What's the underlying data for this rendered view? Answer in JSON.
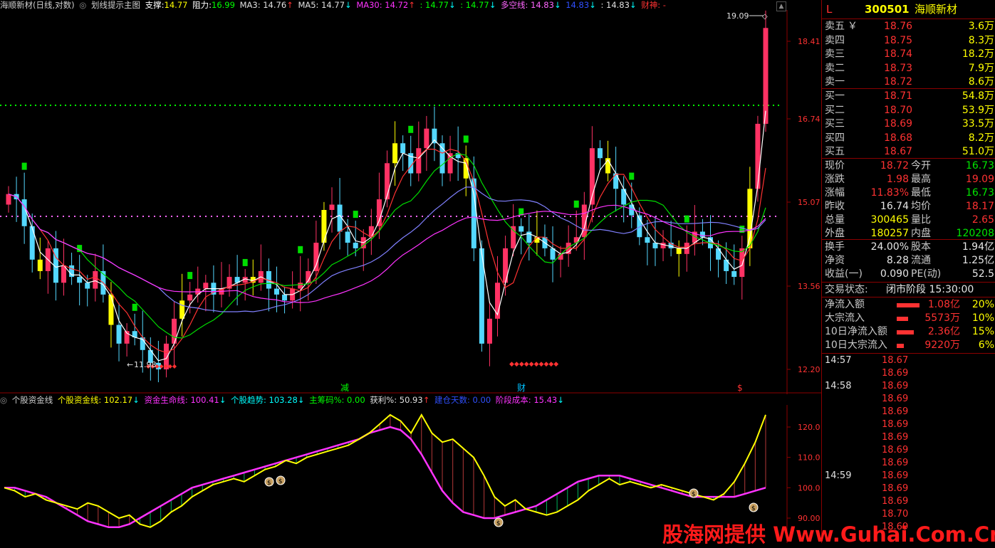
{
  "main_header": {
    "title": "海顺新材(日线,对数)",
    "indicator": "划线提示主图",
    "support_label": "支撑:",
    "support": "14.77",
    "resist_label": "阻力:",
    "resist": "16.99",
    "ma3": "MA3: 14.76",
    "ma5": "MA5: 14.77",
    "ma30": "MA30: 14.72",
    "v1": ": 14.77",
    "v2": ": 14.77",
    "duokong": "多空线: 14.83",
    "v3": "14.83",
    "v4": ": 14.83",
    "caishen": "财神: -"
  },
  "main_axis": {
    "ticks": [
      "18.41",
      "16.74",
      "15.07",
      "13.56",
      "12.20"
    ]
  },
  "main_annotations": {
    "high": "19.09",
    "low": "11.98",
    "jian": "减",
    "cai": "财",
    "dollar": "$"
  },
  "sub_header": {
    "name": "个股资金线",
    "gold": "个股资金线: 102.17",
    "life": "资金生命线: 100.41",
    "trend": "个股趋势: 103.28",
    "chips": "主筹码%: 0.00",
    "profit": "获利%: 50.93",
    "days": "建仓天数: 0.00",
    "cost": "阶段成本: 15.43"
  },
  "sub_axis": {
    "ticks": [
      "120.0",
      "110.0",
      "100.0",
      "90.00"
    ]
  },
  "quote": {
    "flag": "L",
    "code": "300501",
    "name": "海顺新材",
    "asks": [
      {
        "label": "卖五",
        "price": "18.76",
        "vol": "3.6万",
        "mark": "￥"
      },
      {
        "label": "卖四",
        "price": "18.75",
        "vol": "8.3万"
      },
      {
        "label": "卖三",
        "price": "18.74",
        "vol": "18.2万"
      },
      {
        "label": "卖二",
        "price": "18.73",
        "vol": "7.9万"
      },
      {
        "label": "卖一",
        "price": "18.72",
        "vol": "8.6万"
      }
    ],
    "bids": [
      {
        "label": "买一",
        "price": "18.71",
        "vol": "54.8万"
      },
      {
        "label": "买二",
        "price": "18.70",
        "vol": "53.9万"
      },
      {
        "label": "买三",
        "price": "18.69",
        "vol": "33.5万"
      },
      {
        "label": "买四",
        "price": "18.68",
        "vol": "8.2万"
      },
      {
        "label": "买五",
        "price": "18.67",
        "vol": "51.0万"
      }
    ],
    "stats": [
      {
        "l1": "现价",
        "v1": "18.72",
        "l2": "今开",
        "v2": "16.73"
      },
      {
        "l1": "涨跌",
        "v1": "1.98",
        "l2": "最高",
        "v2": "19.09"
      },
      {
        "l1": "涨幅",
        "v1": "11.83%",
        "l2": "最低",
        "v2": "16.73"
      },
      {
        "l1": "昨收",
        "v1": "16.74",
        "l2": "均价",
        "v2": "18.17"
      },
      {
        "l1": "总量",
        "v1": "300465",
        "l2": "量比",
        "v2": "2.65"
      },
      {
        "l1": "外盘",
        "v1": "180257",
        "l2": "内盘",
        "v2": "120208"
      }
    ],
    "stats2": [
      {
        "l1": "换手",
        "v1": "24.00%",
        "l2": "股本",
        "v2": "1.94亿"
      },
      {
        "l1": "净资",
        "v1": "8.28",
        "l2": "流通",
        "v2": "1.25亿"
      },
      {
        "l1": "收益(一)",
        "v1": "0.090",
        "l2": "PE(动)",
        "v2": "52.5"
      }
    ],
    "status_label": "交易状态:",
    "status": "闭市阶段 15:30:00",
    "flows": [
      {
        "label": "净流入额",
        "value": "1.08亿",
        "pct": "20%",
        "bar": 0.2
      },
      {
        "label": "大宗流入",
        "value": "5573万",
        "pct": "10%",
        "bar": 0.1
      },
      {
        "label": "10日净流入额",
        "value": "2.36亿",
        "pct": "15%",
        "bar": 0.15
      },
      {
        "label": "10日大宗流入",
        "value": "9220万",
        "pct": "6%",
        "bar": 0.06
      }
    ],
    "ticks": [
      {
        "time": "14:57",
        "price": "18.67"
      },
      {
        "time": "",
        "price": "18.69"
      },
      {
        "time": "14:58",
        "price": "18.69"
      },
      {
        "time": "",
        "price": "18.69"
      },
      {
        "time": "",
        "price": "18.69"
      },
      {
        "time": "",
        "price": "18.69"
      },
      {
        "time": "",
        "price": "18.69"
      },
      {
        "time": "",
        "price": "18.69"
      },
      {
        "time": "",
        "price": "18.69"
      },
      {
        "time": "14:59",
        "price": "18.69"
      },
      {
        "time": "",
        "price": "18.69"
      },
      {
        "time": "",
        "price": "18.69"
      },
      {
        "time": "",
        "price": "18.70"
      },
      {
        "time": "",
        "price": "18.69"
      }
    ]
  },
  "watermark": "股海网提供 Www.Guhai.Com.Cn",
  "chart_data": {
    "type": "line",
    "series": [
      {
        "name": "个股资金线",
        "values": [
          100,
          99,
          97,
          98,
          96,
          95,
          94,
          93,
          95,
          94,
          92,
          90,
          91,
          88,
          87,
          89,
          92,
          94,
          97,
          99,
          101,
          102,
          103,
          102,
          104,
          106,
          107,
          109,
          108,
          110,
          111,
          112,
          113,
          114,
          116,
          118,
          121,
          124,
          122,
          118,
          124,
          118,
          115,
          116,
          113,
          110,
          104,
          97,
          94,
          96,
          93,
          92,
          91,
          92,
          94,
          96,
          99,
          101,
          103,
          101,
          102,
          101,
          100,
          101,
          100,
          99,
          98,
          97,
          96,
          98,
          102,
          108,
          115,
          124
        ]
      },
      {
        "name": "资金生命线",
        "values": [
          100,
          100,
          99,
          98,
          97,
          95,
          93,
          91,
          89,
          88,
          87,
          87,
          88,
          90,
          92,
          94,
          96,
          98,
          100,
          101,
          102,
          103,
          104,
          105,
          106,
          107,
          108,
          109,
          110,
          111,
          112,
          113,
          114,
          115,
          116,
          118,
          119,
          120,
          119,
          116,
          111,
          105,
          99,
          95,
          92,
          91,
          90,
          90,
          91,
          92,
          93,
          94,
          96,
          98,
          100,
          102,
          103,
          104,
          104,
          104,
          103,
          102,
          101,
          100,
          99,
          98,
          97,
          97,
          97,
          97,
          97,
          98,
          99,
          100
        ]
      }
    ]
  }
}
